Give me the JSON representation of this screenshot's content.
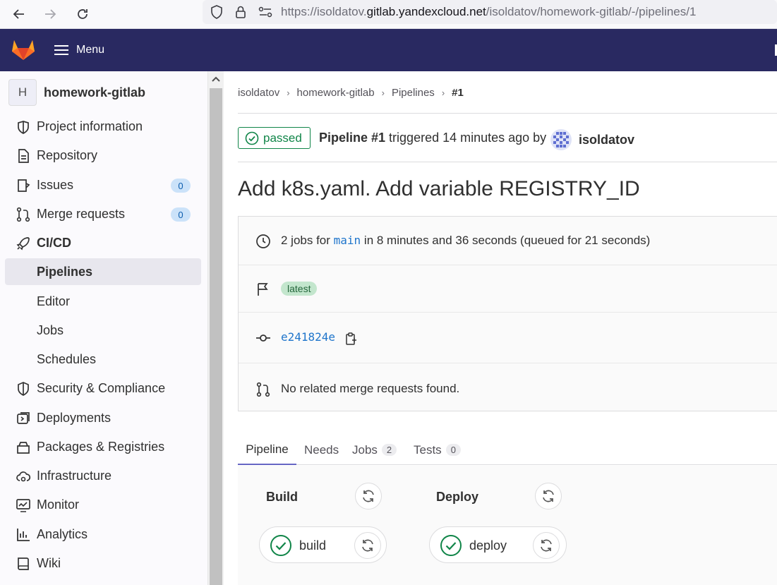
{
  "browser": {
    "url_prefix": "https://isoldatov.",
    "url_host": "gitlab.yandexcloud.net",
    "url_path": "/isoldatov/homework-gitlab/-/pipelines/1"
  },
  "header": {
    "menu_label": "Menu"
  },
  "sidebar": {
    "project_avatar_letter": "H",
    "project_name": "homework-gitlab",
    "items": [
      {
        "label": "Project information",
        "icon": "project-info-icon"
      },
      {
        "label": "Repository",
        "icon": "document-icon"
      },
      {
        "label": "Issues",
        "icon": "issues-icon",
        "count": "0"
      },
      {
        "label": "Merge requests",
        "icon": "merge-request-icon",
        "count": "0"
      },
      {
        "label": "CI/CD",
        "icon": "rocket-icon"
      },
      {
        "label": "Pipelines"
      },
      {
        "label": "Editor"
      },
      {
        "label": "Jobs"
      },
      {
        "label": "Schedules"
      },
      {
        "label": "Security & Compliance",
        "icon": "shield-icon"
      },
      {
        "label": "Deployments",
        "icon": "deployments-icon"
      },
      {
        "label": "Packages & Registries",
        "icon": "package-icon"
      },
      {
        "label": "Infrastructure",
        "icon": "cloud-gear-icon"
      },
      {
        "label": "Monitor",
        "icon": "monitor-icon"
      },
      {
        "label": "Analytics",
        "icon": "chart-icon"
      },
      {
        "label": "Wiki",
        "icon": "book-icon"
      }
    ]
  },
  "breadcrumb": [
    "isoldatov",
    "homework-gitlab",
    "Pipelines",
    "#1"
  ],
  "pipeline": {
    "status": "passed",
    "name": "Pipeline #1",
    "triggered_text": " triggered 14 minutes ago by",
    "user": "isoldatov",
    "title": "Add k8s.yaml. Add variable REGISTRY_ID",
    "jobs_prefix": "2 jobs for ",
    "branch": "main",
    "jobs_suffix": " in 8 minutes and 36 seconds (queued for 21 seconds)",
    "tag": "latest",
    "commit": "e241824e",
    "mr_text": "No related merge requests found."
  },
  "tabs": [
    {
      "label": "Pipeline"
    },
    {
      "label": "Needs"
    },
    {
      "label": "Jobs",
      "count": "2"
    },
    {
      "label": "Tests",
      "count": "0"
    }
  ],
  "stages": [
    {
      "title": "Build",
      "job": "build"
    },
    {
      "title": "Deploy",
      "job": "deploy"
    }
  ],
  "colors": {
    "header_bg": "#292961",
    "success": "#108548",
    "link": "#1f75cb"
  }
}
